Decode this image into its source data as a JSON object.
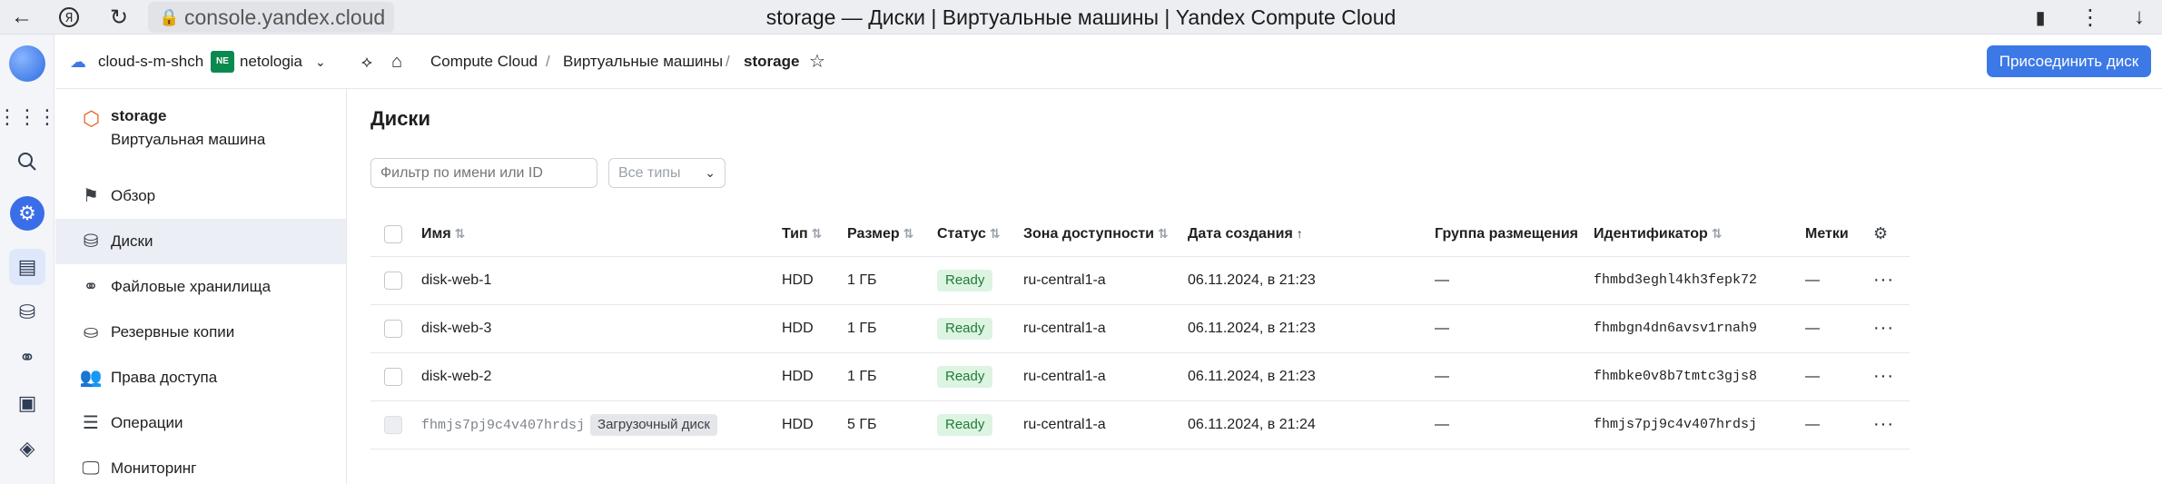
{
  "browser": {
    "url": "console.yandex.cloud",
    "title": "storage — Диски | Виртуальные машины | Yandex Compute Cloud"
  },
  "header": {
    "cloud": "cloud-s-m-shch",
    "folder_badge": "NE",
    "folder": "netologia",
    "breadcrumb": [
      "Compute Cloud",
      "Виртуальные машины",
      "storage"
    ],
    "breadcrumb_sep": "/",
    "join_button": "Присоединить диск"
  },
  "sidebar": {
    "vm_name": "storage",
    "vm_type": "Виртуальная машина",
    "items": [
      {
        "label": "Обзор",
        "icon": "flag-icon"
      },
      {
        "label": "Диски",
        "icon": "disk-icon",
        "active": true
      },
      {
        "label": "Файловые хранилища",
        "icon": "share-icon"
      },
      {
        "label": "Резервные копии",
        "icon": "backup-icon"
      },
      {
        "label": "Права доступа",
        "icon": "users-icon"
      },
      {
        "label": "Операции",
        "icon": "list-icon"
      },
      {
        "label": "Мониторинг",
        "icon": "monitor-icon"
      }
    ]
  },
  "main": {
    "title": "Диски",
    "filter_placeholder": "Фильтр по имени или ID",
    "type_select": "Все типы",
    "columns": {
      "name": "Имя",
      "type": "Тип",
      "size": "Размер",
      "status": "Статус",
      "zone": "Зона доступности",
      "created": "Дата создания",
      "placement": "Группа размещения",
      "id": "Идентификатор",
      "labels": "Метки"
    },
    "rows": [
      {
        "name": "disk-web-1",
        "type": "HDD",
        "size": "1 ГБ",
        "status": "Ready",
        "zone": "ru-central1-a",
        "created": "06.11.2024, в 21:23",
        "placement": "—",
        "id": "fhmbd3eghl4kh3fepk72",
        "labels": "—"
      },
      {
        "name": "disk-web-3",
        "type": "HDD",
        "size": "1 ГБ",
        "status": "Ready",
        "zone": "ru-central1-a",
        "created": "06.11.2024, в 21:23",
        "placement": "—",
        "id": "fhmbgn4dn6avsv1rnah9",
        "labels": "—"
      },
      {
        "name": "disk-web-2",
        "type": "HDD",
        "size": "1 ГБ",
        "status": "Ready",
        "zone": "ru-central1-a",
        "created": "06.11.2024, в 21:23",
        "placement": "—",
        "id": "fhmbke0v8b7tmtc3gjs8",
        "labels": "—"
      },
      {
        "name": "fhmjs7pj9c4v407hrdsj",
        "boot_badge": "Загрузочный диск",
        "type": "HDD",
        "size": "5 ГБ",
        "status": "Ready",
        "zone": "ru-central1-a",
        "created": "06.11.2024, в 21:24",
        "placement": "—",
        "id": "fhmjs7pj9c4v407hrdsj",
        "labels": "—"
      }
    ]
  }
}
